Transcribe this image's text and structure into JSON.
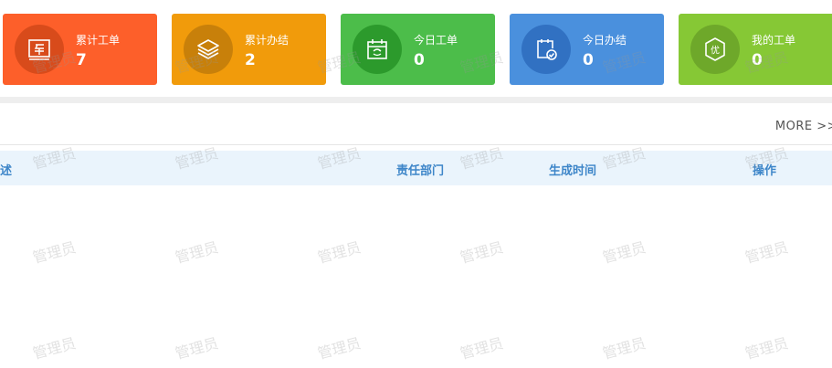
{
  "cards": [
    {
      "title": "累计工单",
      "count": "7",
      "icon": "year-calendar-icon",
      "color": "#fd5f2a",
      "circle": "#d84b1b"
    },
    {
      "title": "累计办结",
      "count": "2",
      "icon": "layers-icon",
      "color": "#f19b0b",
      "circle": "#c8800a"
    },
    {
      "title": "今日工单",
      "count": "0",
      "icon": "today-calendar-icon",
      "color": "#4cbd4a",
      "circle": "#2c9a2c"
    },
    {
      "title": "今日办结",
      "count": "0",
      "icon": "clipboard-check-icon",
      "color": "#4a90dd",
      "circle": "#3171c2"
    },
    {
      "title": "我的工单",
      "count": "0",
      "icon": "hexagon-badge-icon",
      "color": "#86c835",
      "circle": "#6ea82a"
    }
  ],
  "more_label": "MORE >>",
  "table": {
    "headers": [
      "述",
      "责任部门",
      "生成时间",
      "操作"
    ]
  },
  "watermark": "管理员"
}
